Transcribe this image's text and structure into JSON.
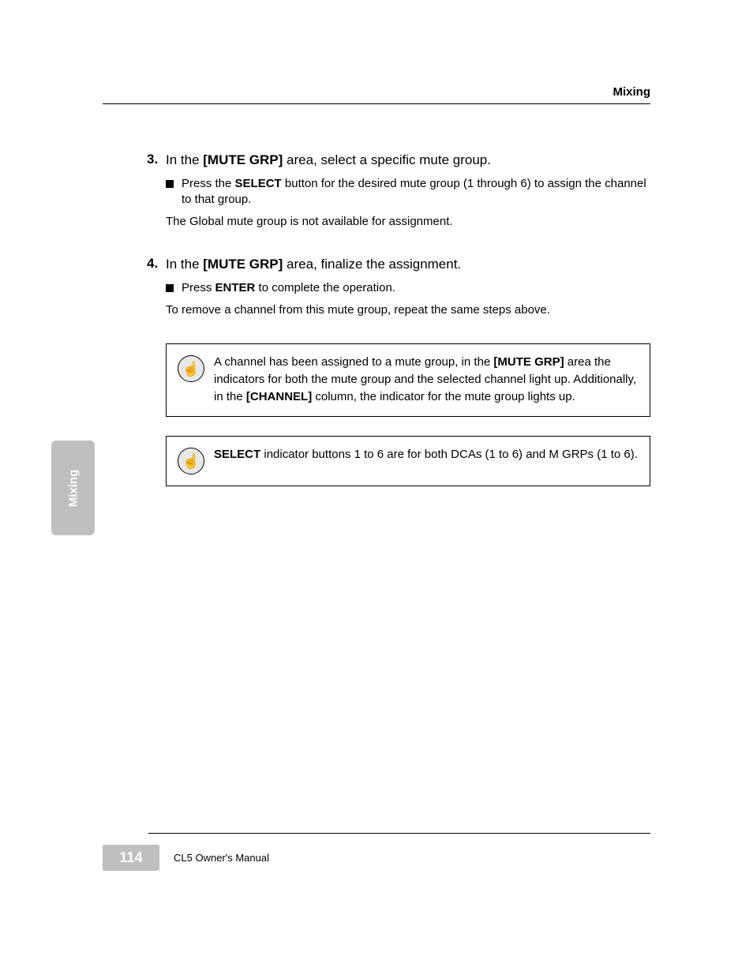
{
  "header": {
    "title": "Mixing"
  },
  "sideTab": "Mixing",
  "step3": {
    "num": "3.",
    "textBefore": "In the ",
    "key": "[MUTE GRP]",
    "textAfter": " area, select a specific mute group."
  },
  "step3sub": {
    "before": "Press the ",
    "key": "SELECT",
    "after": " button for the desired mute group (1 through 6) to assign the channel to that group."
  },
  "step3note": "The Global mute group is not available for assignment.",
  "step4": {
    "num": "4.",
    "before": "In the ",
    "key": "[MUTE GRP]",
    "after": " area, finalize the assignment."
  },
  "step4sub": {
    "before": "Press ",
    "key": "ENTER",
    "after": " to complete the operation."
  },
  "step4note": "To remove a channel from this mute group, repeat the same steps above.",
  "note1": {
    "before": "A channel has been assigned to a mute group, in the ",
    "key1": "[MUTE GRP]",
    "mid": " area the indicators for both the mute group and the selected channel light up. Additionally, in the ",
    "key2": "[CHANNEL]",
    "after": " column, the indicator for the mute group lights up."
  },
  "note2": {
    "before": "",
    "key": "SELECT",
    "after": " indicator buttons 1 to 6 are for both DCAs (1 to 6) and M GRPs (1 to 6)."
  },
  "footer": {
    "pageNum": "114",
    "label": "CL5 Owner's Manual"
  }
}
